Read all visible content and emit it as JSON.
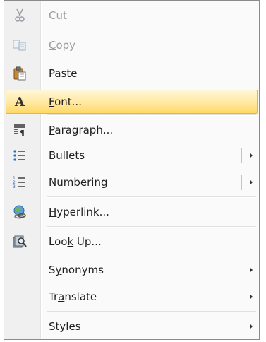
{
  "menu": {
    "items": [
      {
        "label": "Cut",
        "mnemonic": "t",
        "icon": "scissors-icon",
        "enabled": false
      },
      {
        "label": "Copy",
        "mnemonic": "C",
        "icon": "copy-icon",
        "enabled": false
      },
      {
        "label": "Paste",
        "mnemonic": "P",
        "icon": "paste-icon",
        "enabled": true
      },
      {
        "label": "Font...",
        "mnemonic": "F",
        "icon": "font-icon",
        "enabled": true,
        "highlighted": true
      },
      {
        "label": "Paragraph...",
        "mnemonic": "P",
        "icon": "paragraph-icon",
        "enabled": true
      },
      {
        "label": "Bullets",
        "mnemonic": "B",
        "icon": "bullets-icon",
        "enabled": true,
        "submenu": true,
        "split": true
      },
      {
        "label": "Numbering",
        "mnemonic": "N",
        "icon": "numbering-icon",
        "enabled": true,
        "submenu": true,
        "split": true
      },
      {
        "label": "Hyperlink...",
        "mnemonic": "H",
        "icon": "hyperlink-icon",
        "enabled": true
      },
      {
        "label": "Look Up...",
        "mnemonic": "k",
        "icon": "research-icon",
        "enabled": true
      },
      {
        "label": "Synonyms",
        "mnemonic": "y",
        "icon": "",
        "enabled": true,
        "submenu": true
      },
      {
        "label": "Translate",
        "mnemonic": "a",
        "icon": "",
        "enabled": true,
        "submenu": true
      },
      {
        "label": "Styles",
        "mnemonic": "t",
        "icon": "",
        "enabled": true,
        "submenu": true
      }
    ],
    "colors": {
      "highlight": "#ffe8a0",
      "highlight_border": "#e4b44d",
      "disabled_text": "#9d9d9d"
    }
  }
}
